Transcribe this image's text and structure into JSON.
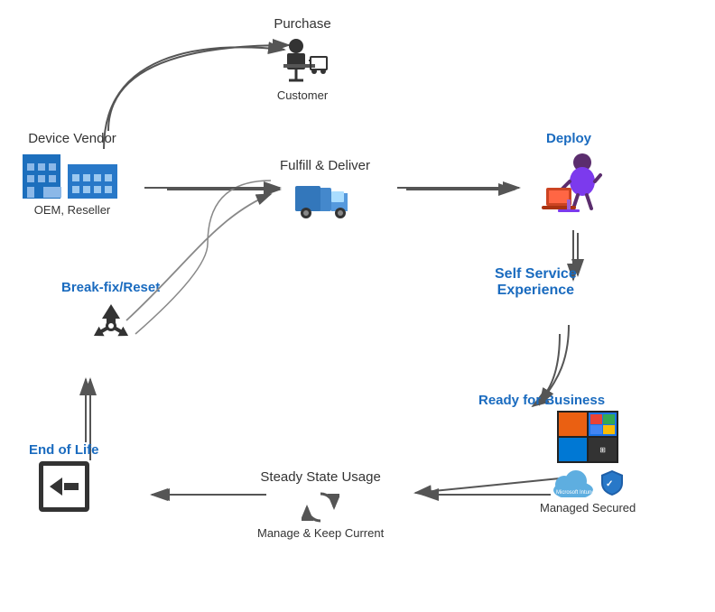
{
  "nodes": {
    "purchase": {
      "label": "Purchase",
      "sublabel": "Customer",
      "color": "black"
    },
    "device_vendor": {
      "label": "Device Vendor",
      "sublabel": "OEM, Reseller",
      "color": "black"
    },
    "fulfill": {
      "label": "Fulfill & Deliver",
      "color": "black"
    },
    "deploy": {
      "label": "Deploy",
      "color": "blue"
    },
    "self_service": {
      "label": "Self Service\nExperience",
      "color": "blue"
    },
    "ready_for_business": {
      "label": "Ready for Business",
      "color": "blue"
    },
    "managed_secured": {
      "label": "Managed Secured",
      "color": "black"
    },
    "steady_state": {
      "label": "Steady State Usage",
      "color": "black"
    },
    "manage_keep_current": {
      "label": "Manage & Keep Current",
      "color": "black"
    },
    "break_fix": {
      "label": "Break-fix/Reset",
      "color": "blue"
    },
    "end_of_life": {
      "label": "End of Life",
      "color": "blue"
    }
  }
}
